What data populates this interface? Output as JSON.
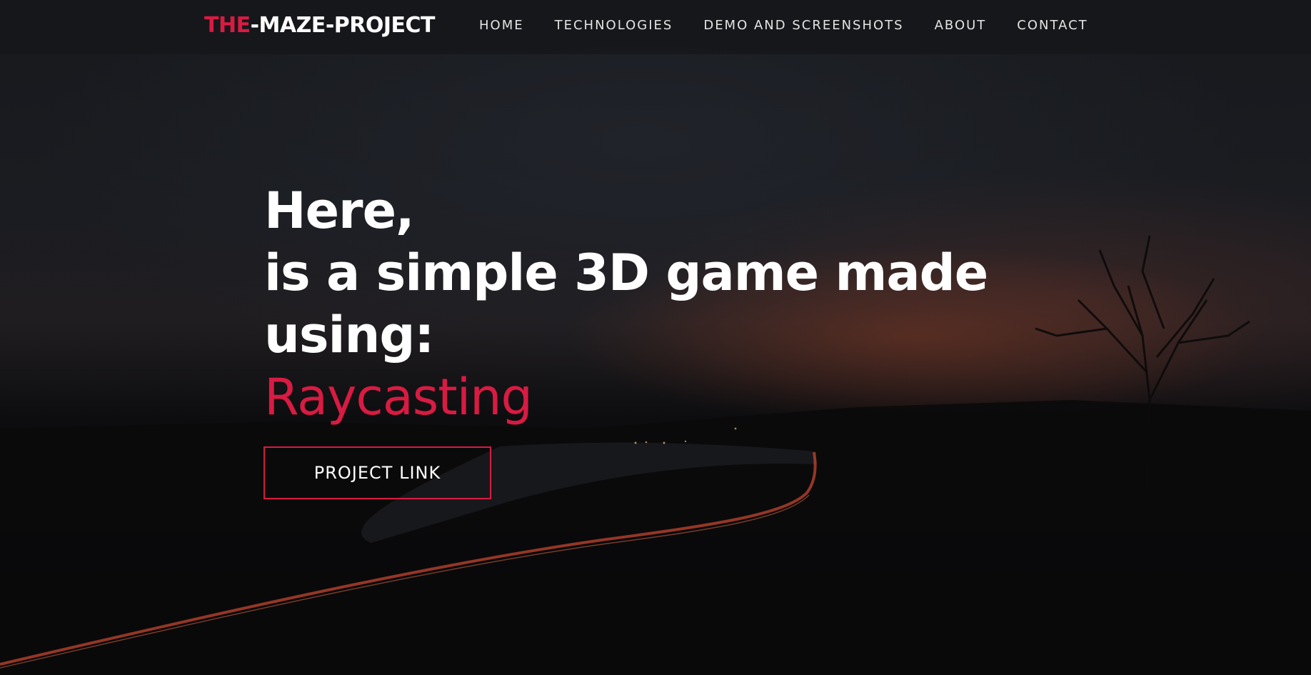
{
  "brand": {
    "accent": "THE",
    "rest": "-MAZE-PROJECT"
  },
  "nav": {
    "items": [
      {
        "label": "HOME"
      },
      {
        "label": "TECHNOLOGIES"
      },
      {
        "label": "DEMO AND SCREENSHOTS"
      },
      {
        "label": "ABOUT"
      },
      {
        "label": "CONTACT"
      }
    ]
  },
  "hero": {
    "line1": "Here,",
    "line2": "is a simple 3D game made",
    "line3": "using:",
    "highlight": "Raycasting",
    "button_label": "PROJECT LINK"
  },
  "colors": {
    "accent": "#d81b42",
    "text": "#ffffff",
    "nav_bg": "#16171a"
  }
}
